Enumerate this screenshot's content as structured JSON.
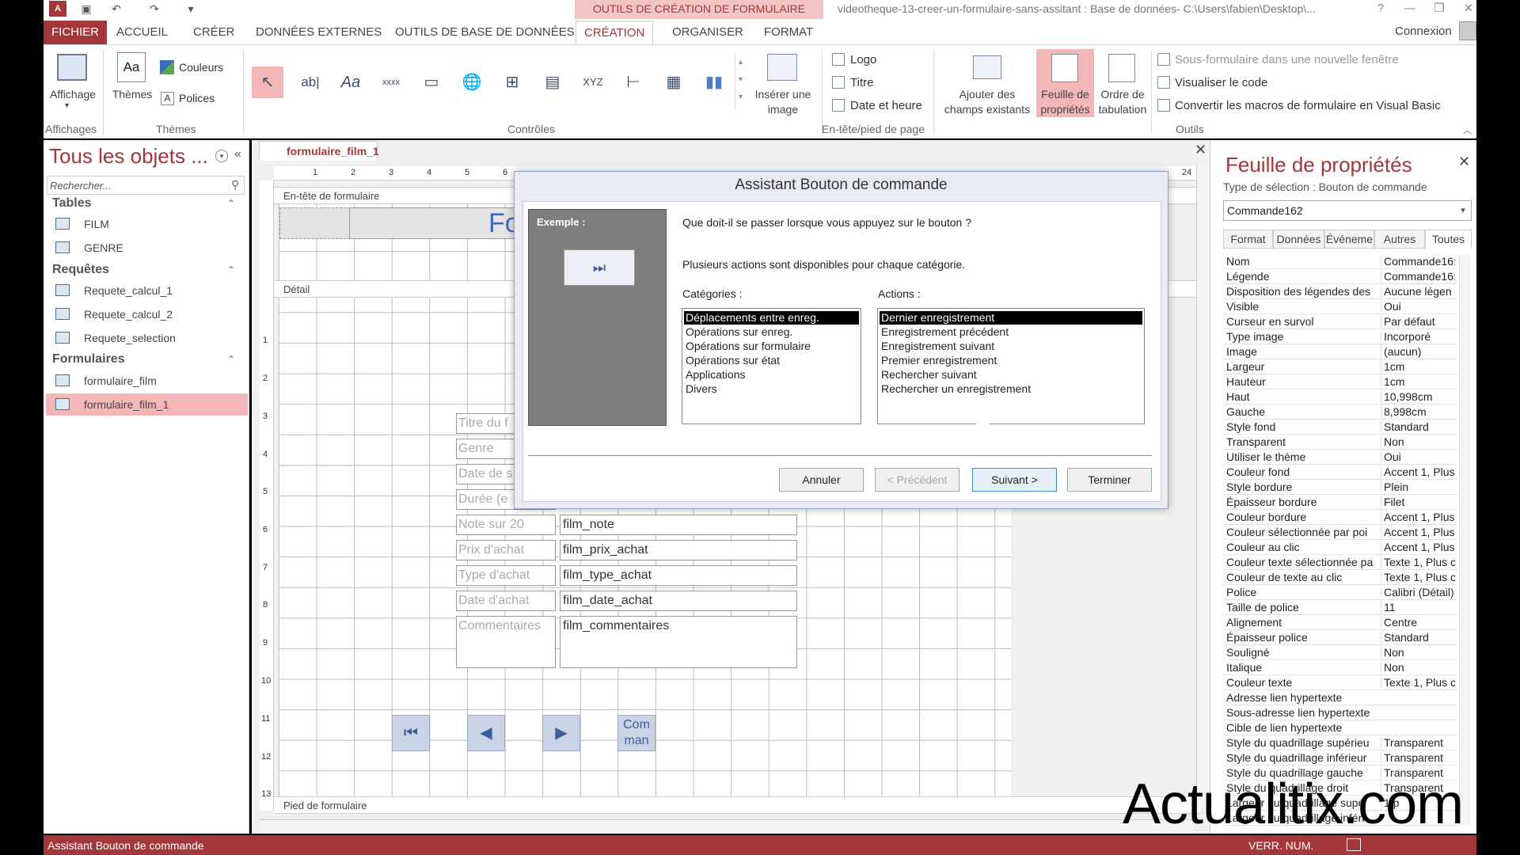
{
  "window": {
    "contextual_tab_group": "OUTILS DE CRÉATION DE FORMULAIRE",
    "title": "videotheque-13-creer-un-formulaire-sans-assitant : Base de données- C:\\Users\\fabien\\Desktop\\...",
    "app_logo": "A",
    "help": "?",
    "minimize": "—",
    "restore": "❐",
    "close": "✕"
  },
  "quick_access": {
    "save": "▣",
    "undo": "↶",
    "redo": "↷",
    "more": "▾"
  },
  "tabs": [
    "FICHIER",
    "ACCUEIL",
    "CRÉER",
    "DONNÉES EXTERNES",
    "OUTILS DE BASE DE DONNÉES",
    "CRÉATION",
    "ORGANISER",
    "FORMAT"
  ],
  "connexion": "Connexion",
  "ribbon": {
    "affichage": "Affichage",
    "themes": "Thèmes",
    "couleurs": "Couleurs",
    "polices": "Polices",
    "group_affichages": "Affichages",
    "group_themes": "Thèmes",
    "group_controles": "Contrôles",
    "inserer_image_1": "Insérer une",
    "inserer_image_2": "image",
    "logo": "Logo",
    "titre": "Titre",
    "date_heure": "Date et heure",
    "group_entete": "En-tête/pied de page",
    "ajouter_champs_1": "Ajouter des",
    "ajouter_champs_2": "champs existants",
    "feuille_props_1": "Feuille de",
    "feuille_props_2": "propriétés",
    "ordre_tab_1": "Ordre de",
    "ordre_tab_2": "tabulation",
    "sous_formulaire": "Sous-formulaire dans une nouvelle fenêtre",
    "visualiser_code": "Visualiser le code",
    "convertir_macros": "Convertir les macros de formulaire en Visual Basic",
    "group_outils": "Outils",
    "controls": [
      "↖",
      "ab|",
      "Aa",
      "xxxx",
      "▭",
      "🌐",
      "⊞",
      "▤",
      "XYZ",
      "⊢",
      "▦",
      "▮▮"
    ]
  },
  "nav": {
    "title": "Tous les objets ...",
    "search_placeholder": "Rechercher...",
    "sections": [
      {
        "label": "Tables",
        "items": [
          "FILM",
          "GENRE"
        ]
      },
      {
        "label": "Requêtes",
        "items": [
          "Requete_calcul_1",
          "Requete_calcul_2",
          "Requete_selection"
        ]
      },
      {
        "label": "Formulaires",
        "items": [
          "formulaire_film",
          "formulaire_film_1"
        ]
      }
    ]
  },
  "document": {
    "tab": "formulaire_film_1",
    "section_header": "En-tête de formulaire",
    "section_detail": "Détail",
    "section_footer": "Pied de formulaire",
    "header_text": "Fo",
    "ruler_top": [
      "1",
      "2",
      "3",
      "4",
      "5",
      "6",
      "24"
    ],
    "ruler_left": [
      "1",
      "2",
      "3",
      "4",
      "5",
      "6",
      "7",
      "8",
      "9",
      "10",
      "11",
      "12",
      "13"
    ],
    "labels": [
      "Titre du f",
      "Genre",
      "Date de s",
      "Durée (e",
      "Note sur 20",
      "Prix d'achat",
      "Type d'achat",
      "Date d'achat",
      "Commentaires"
    ],
    "fields": [
      "film_note",
      "film_prix_achat",
      "film_type_achat",
      "film_date_achat",
      "film_commentaires"
    ],
    "nav_buttons": [
      "⏮",
      "◀",
      "▶"
    ],
    "command_button_line1": "Com",
    "command_button_line2": "man"
  },
  "dialog": {
    "title": "Assistant Bouton de commande",
    "example_label": "Exemple :",
    "example_icon": "⏭",
    "question": "Que doit-il se passer lorsque vous appuyez sur le bouton ?",
    "info": "Plusieurs actions sont disponibles pour chaque catégorie.",
    "categories_label": "Catégories :",
    "actions_label": "Actions :",
    "categories": [
      "Déplacements entre enreg.",
      "Opérations sur enreg.",
      "Opérations sur formulaire",
      "Opérations sur état",
      "Applications",
      "Divers"
    ],
    "selected_category": 0,
    "actions": [
      "Dernier enregistrement",
      "Enregistrement précédent",
      "Enregistrement suivant",
      "Premier enregistrement",
      "Rechercher suivant",
      "Rechercher un enregistrement"
    ],
    "selected_action": 0,
    "buttons": {
      "cancel": "Annuler",
      "previous": "< Précédent",
      "next": "Suivant >",
      "finish": "Terminer"
    }
  },
  "properties": {
    "title": "Feuille de propriétés",
    "selection_type": "Type de sélection :  Bouton de commande",
    "combo_value": "Commande162",
    "tabs": [
      "Format",
      "Données",
      "Événeme",
      "Autres",
      "Toutes"
    ],
    "active_tab": "Toutes",
    "rows": [
      [
        "Nom",
        "Commande16:"
      ],
      [
        "Légende",
        "Commande16:"
      ],
      [
        "Disposition des légendes des",
        "Aucune légen"
      ],
      [
        "Visible",
        "Oui"
      ],
      [
        "Curseur en survol",
        "Par défaut"
      ],
      [
        "Type image",
        "Incorporé"
      ],
      [
        "Image",
        "(aucun)"
      ],
      [
        "Largeur",
        "1cm"
      ],
      [
        "Hauteur",
        "1cm"
      ],
      [
        "Haut",
        "10,998cm"
      ],
      [
        "Gauche",
        "8,998cm"
      ],
      [
        "Style fond",
        "Standard"
      ],
      [
        "Transparent",
        "Non"
      ],
      [
        "Utiliser le thème",
        "Oui"
      ],
      [
        "Couleur fond",
        "Accent 1, Plus"
      ],
      [
        "Style bordure",
        "Plein"
      ],
      [
        "Épaisseur bordure",
        "Filet"
      ],
      [
        "Couleur bordure",
        "Accent 1, Plus"
      ],
      [
        "Couleur sélectionnée par poi",
        "Accent 1, Plus"
      ],
      [
        "Couleur au clic",
        "Accent 1, Plus"
      ],
      [
        "Couleur texte sélectionnée pa",
        "Texte 1, Plus cl"
      ],
      [
        "Couleur de texte au clic",
        "Texte 1, Plus cl"
      ],
      [
        "Police",
        "Calibri (Détail)"
      ],
      [
        "Taille de police",
        "11"
      ],
      [
        "Alignement",
        "Centre"
      ],
      [
        "Épaisseur police",
        "Standard"
      ],
      [
        "Souligné",
        "Non"
      ],
      [
        "Italique",
        "Non"
      ],
      [
        "Couleur texte",
        "Texte 1, Plus cl"
      ],
      [
        "Adresse lien hypertexte",
        ""
      ],
      [
        "Sous-adresse lien hypertexte",
        ""
      ],
      [
        "Cible de lien hypertexte",
        ""
      ],
      [
        "Style du quadrillage supérieu",
        "Transparent"
      ],
      [
        "Style du quadrillage inférieur",
        "Transparent"
      ],
      [
        "Style du quadrillage gauche",
        "Transparent"
      ],
      [
        "Style du quadrillage droit",
        "Transparent"
      ],
      [
        "Largeur du quadrillage supé",
        "1 p"
      ],
      [
        "Largeur du quadrillage inféri",
        ""
      ]
    ]
  },
  "status": {
    "left": "Assistant Bouton de commande",
    "right": "VERR. NUM."
  },
  "watermark": "Actualitix.com",
  "colors": {
    "accent": "#a4373a",
    "selection": "#f4b7b7"
  }
}
